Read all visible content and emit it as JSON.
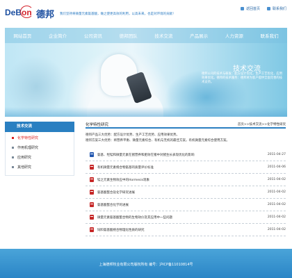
{
  "header": {
    "logo_en_de": "DeB",
    "logo_en_bon": "on",
    "logo_cn": "德邦",
    "slogan": "我们坚持将微量元素氨基酸，做之使更高效的利用，以高未来，也是对环境的贡献！",
    "links": [
      {
        "label": "返回首页",
        "icon": "home-icon"
      },
      {
        "label": "联系我们",
        "icon": "contact-icon"
      }
    ]
  },
  "nav": [
    "网站首页",
    "企业简介",
    "公司资讯",
    "德邦团队",
    "技术交流",
    "产品展示",
    "人力资源",
    "联系我们"
  ],
  "banner": {
    "title": "技术交流",
    "text": "德邦公司的技术与研发：配方设计优化，生产工艺优化，应用效果优化。德邦的技术服务：德邦将为客户提供全面完善的技术支持。"
  },
  "sidebar": {
    "title": "技术交流",
    "items": [
      "化学特性研究",
      "作用机理研究",
      "应用研究",
      "其他研究"
    ]
  },
  "main": {
    "title": "化学特性研究",
    "breadcrumb": "首页>>技术交流>>化学特性研究",
    "intro": [
      "德邦产品三大优势：配方设计优势、生产工艺优势、应用效果优势。",
      "德邦方案三大优势：将营养平衡、微量元素综合、有机与无机的最佳方案，有机微量元素综合使用方案。"
    ],
    "rows": [
      {
        "title": "氨基、羟锰和微量元素在猪营养和肥效在猪中对猪生长表现优化的影响",
        "date": "2011-04-27",
        "icon": "word-doc-icon"
      },
      {
        "title": "有机微量元素络合物氨基的质量评价标准",
        "date": "2011-04-06",
        "icon": "pdf-icon"
      },
      {
        "title": "锰之元素生物效应中的Hormesis现象",
        "date": "2011-04-02",
        "icon": "pdf-icon"
      },
      {
        "title": "氨基酸螯合盐化学研究进展",
        "date": "2011-04-02",
        "icon": "pdf-icon"
      },
      {
        "title": "氨基酸螯合化学的进展",
        "date": "2011-04-02",
        "icon": "pdf-icon"
      },
      {
        "title": "微量元素氨基酸螯合物的生物效价及其应用中一些问题",
        "date": "2011-04-02",
        "icon": "pdf-icon"
      },
      {
        "title": "饲料氨基酸络合物理化性质的研究",
        "date": "2011-04-02",
        "icon": "pdf-icon"
      }
    ]
  },
  "footer": {
    "text": "上海德邦牧业有限公司版权所有 编号：沪ICP备11010814号"
  },
  "colors": {
    "primary": "#2a7fc1",
    "logo_red": "#d4222b",
    "logo_blue": "#1c4fa0",
    "active_link": "#dd2222"
  }
}
